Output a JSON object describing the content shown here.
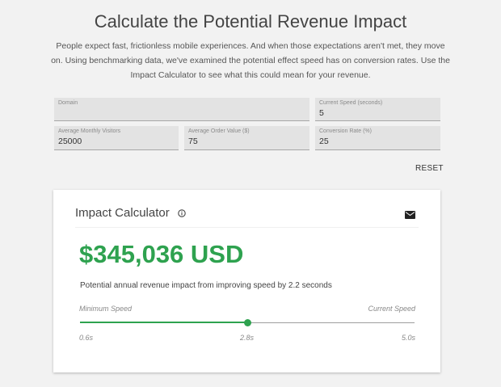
{
  "header": {
    "title": "Calculate the Potential Revenue Impact",
    "intro": "People expect fast, frictionless mobile experiences. And when those expectations aren't met, they move on. Using benchmarking data, we've examined the potential effect speed has on conversion rates. Use the Impact Calculator to see what this could mean for your revenue."
  },
  "form": {
    "domain": {
      "label": "Domain",
      "value": ""
    },
    "current_speed": {
      "label": "Current Speed (seconds)",
      "value": "5"
    },
    "monthly_visitors": {
      "label": "Average Monthly Visitors",
      "value": "25000"
    },
    "order_value": {
      "label": "Average Order Value ($)",
      "value": "75"
    },
    "conversion_rate": {
      "label": "Conversion Rate (%)",
      "value": "25"
    },
    "reset_label": "RESET"
  },
  "calculator": {
    "title": "Impact Calculator",
    "info_icon": "info-icon",
    "mail_icon": "mail-icon",
    "amount": "$345,036 USD",
    "impact_text": "Potential annual revenue impact from improving speed by 2.2 seconds",
    "slider": {
      "min_label": "Minimum Speed",
      "max_label": "Current Speed",
      "min_value": "0.6s",
      "current_value": "2.8s",
      "max_value": "5.0s",
      "position_fraction": 0.5
    },
    "accent_color": "#2ea24f"
  }
}
